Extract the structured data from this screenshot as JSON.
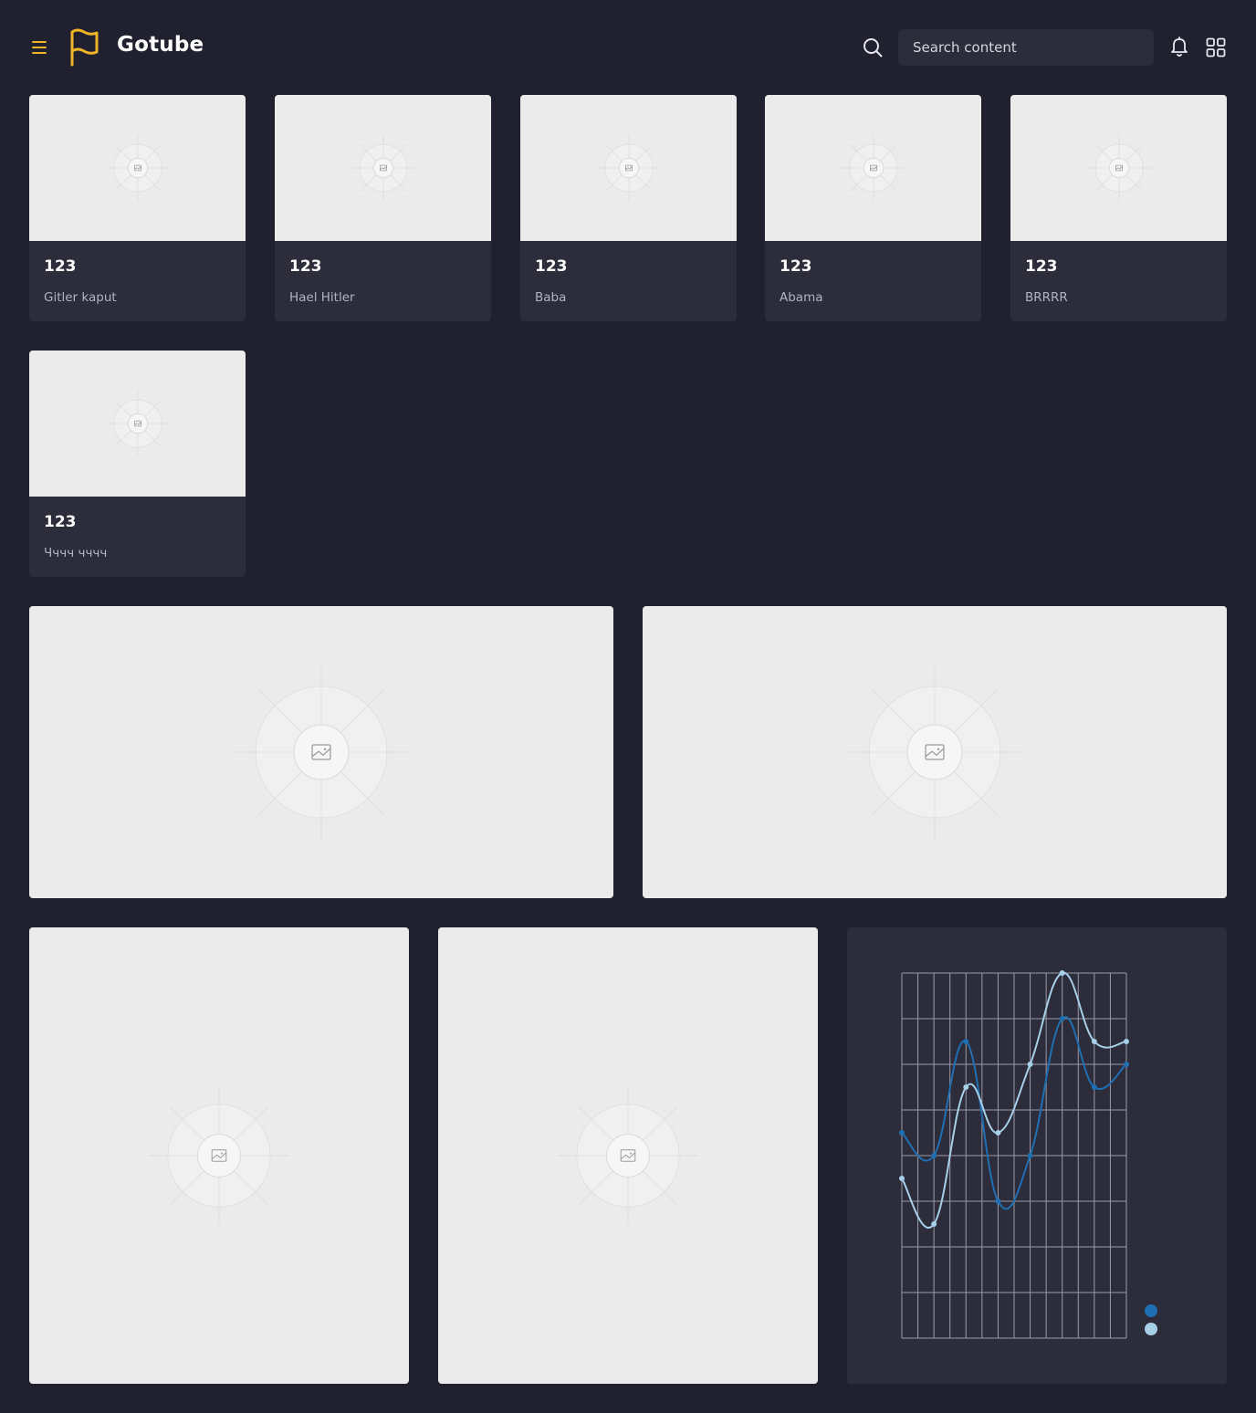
{
  "app": {
    "name": "Gotube",
    "accent_color": "#f0b429",
    "background": "#20202e"
  },
  "header": {
    "menu_icon": "hamburger-menu-icon",
    "logo_icon": "flag-icon",
    "search_icon": "search-icon",
    "search_placeholder": "Search content",
    "notifications_icon": "bell-icon",
    "apps_icon": "grid-icon"
  },
  "cards": [
    {
      "number": "123",
      "title": "Gitler kaput"
    },
    {
      "number": "123",
      "title": "Hael Hitler"
    },
    {
      "number": "123",
      "title": "Baba"
    },
    {
      "number": "123",
      "title": "Abama"
    },
    {
      "number": "123",
      "title": "BRRRR"
    },
    {
      "number": "123",
      "title": "Чччч чччч"
    }
  ],
  "placeholder_icon": "image-placeholder-icon",
  "chart_data": {
    "type": "line",
    "xlabel": "",
    "ylabel": "",
    "x": [
      0,
      1,
      2,
      3,
      4,
      5,
      6,
      7
    ],
    "ylim": [
      0,
      8
    ],
    "grid": true,
    "legend": "bottom-right",
    "series": [
      {
        "color": "#1f6fb2",
        "values": [
          4.5,
          4.0,
          6.5,
          3.0,
          4.0,
          7.0,
          5.5,
          6.0
        ]
      },
      {
        "color": "#a6cfe8",
        "values": [
          3.5,
          2.5,
          5.5,
          4.5,
          6.0,
          8.0,
          6.5,
          6.5
        ]
      }
    ]
  }
}
